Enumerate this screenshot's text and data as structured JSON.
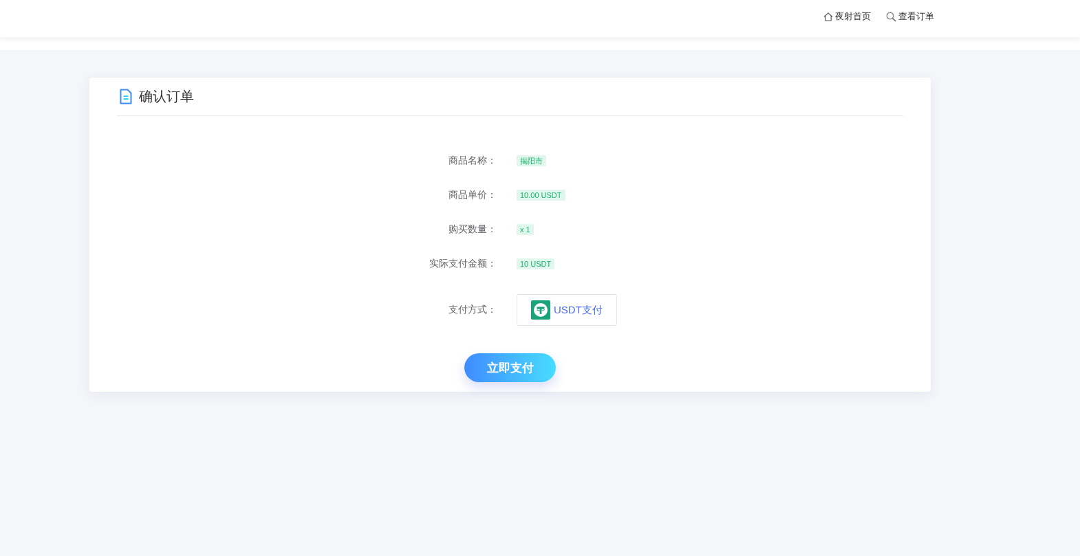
{
  "header": {
    "nav": [
      {
        "kind": "home",
        "label": "夜射首页"
      },
      {
        "kind": "search",
        "label": "查看订单"
      }
    ]
  },
  "card": {
    "title": "确认订单",
    "fields": [
      {
        "label": "商品名称：",
        "value": "揭阳市"
      },
      {
        "label": "商品单价：",
        "value": "10.00 USDT"
      },
      {
        "label": "购买数量：",
        "value": "x 1"
      },
      {
        "label": "实际支付金额：",
        "value": "10 USDT"
      }
    ],
    "payment": {
      "label": "支付方式：",
      "options": [
        {
          "kind": "usdt",
          "label": "USDT支付"
        }
      ]
    },
    "submit": "立即支付"
  }
}
